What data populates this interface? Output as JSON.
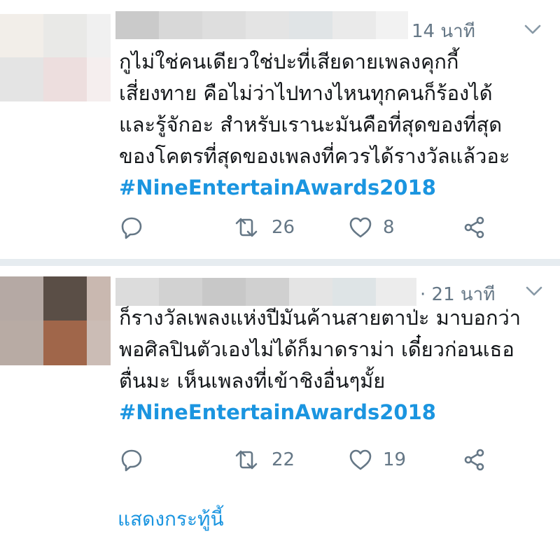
{
  "tweets": [
    {
      "time": "14 นาที",
      "lines": [
        "กูไม่ใช่คนเดียวใช่ปะที่เสียดายเพลงคุกกี้",
        "เสี่ยงทาย คือไม่ว่าไปทางไหนทุกคนก็ร้องได้",
        "และรู้จักอะ สำหรับเรานะมันคือที่สุดของที่สุด",
        "ของโคตรที่สุดของเพลงที่ควรได้รางวัลแล้วอะ"
      ],
      "hashtag": "#NineEntertainAwards2018",
      "retweets": "26",
      "likes": "8",
      "avatar_colors": [
        "#f2eee9",
        "#e9e9e7",
        "#f0f0f0",
        "#e4e4e4",
        "#eddede",
        "#f5eeee"
      ],
      "name_colors": [
        "#cacaca",
        "#d8d8d8",
        "#dedede",
        "#e4e4e4",
        "#e0e4e6",
        "#eaeaea",
        "#f2f2f2"
      ]
    },
    {
      "time": "· 21 นาที",
      "lines": [
        "ก็รางวัลเพลงแห่งปีมันค้านสายตาป่ะ มาบอกว่า",
        "พอศิลปินตัวเองไม่ได้ก็มาดราม่า เดี๋ยวก่อนเธอ",
        "ตื่นมะ เห็นเพลงที่เข้าชิงอื่นๆมั้ย"
      ],
      "hashtag": "#NineEntertainAwards2018",
      "retweets": "22",
      "likes": "19",
      "avatar_colors": [
        "#b5a9a4",
        "#5a4e46",
        "#c9b8b0",
        "#b8aba4",
        "#a0664a",
        "#cbbcb5"
      ],
      "name_colors": [
        "#dcdcdc",
        "#d2d2d2",
        "#c8c8c8",
        "#d0d0d0",
        "#e4e4e4",
        "#dee4e6",
        "#ececec"
      ]
    }
  ],
  "show_thread": "แสดงกระทู้นี้",
  "colors": {
    "accent": "#1b95e0",
    "muted": "#657786",
    "text": "#14171a",
    "divider": "#e6ecf0"
  },
  "icons": [
    "reply-icon",
    "retweet-icon",
    "like-icon",
    "share-icon",
    "chevron-down-icon"
  ]
}
